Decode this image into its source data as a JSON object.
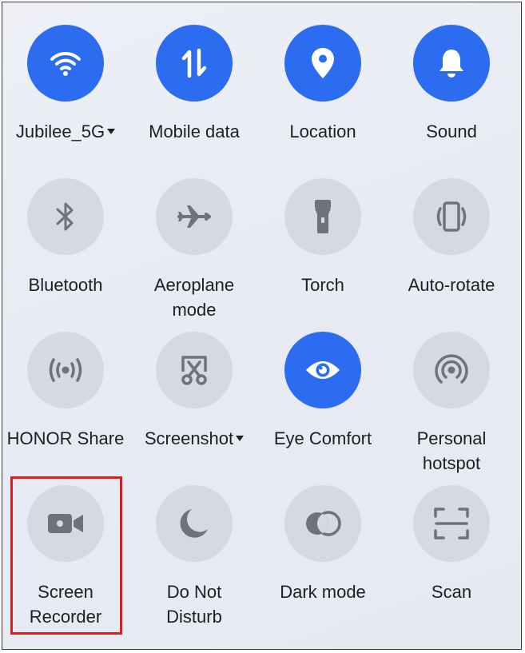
{
  "colors": {
    "active_tile": "#2b6cf0",
    "inactive_tile": "#d6d9e0",
    "active_icon": "#ffffff",
    "inactive_icon": "#6f7379",
    "highlight_border": "#e01b1b"
  },
  "tiles": [
    {
      "label": "Jubilee_5G",
      "icon": "wifi-icon",
      "active": true,
      "dropdown": true
    },
    {
      "label": "Mobile data",
      "icon": "mobile-data-icon",
      "active": true
    },
    {
      "label": "Location",
      "icon": "location-pin-icon",
      "active": true
    },
    {
      "label": "Sound",
      "icon": "bell-icon",
      "active": true
    },
    {
      "label": "Bluetooth",
      "icon": "bluetooth-icon",
      "active": false
    },
    {
      "label_line1": "Aeroplane",
      "label_line2": "mode",
      "icon": "airplane-icon",
      "active": false
    },
    {
      "label": "Torch",
      "icon": "flashlight-icon",
      "active": false
    },
    {
      "label": "Auto-rotate",
      "icon": "auto-rotate-icon",
      "active": false
    },
    {
      "label": "HONOR Share",
      "icon": "share-wave-icon",
      "active": false
    },
    {
      "label": "Screenshot",
      "icon": "screenshot-scissors-icon",
      "active": false,
      "dropdown": true
    },
    {
      "label": "Eye Comfort",
      "icon": "eye-icon",
      "active": true
    },
    {
      "label_line1": "Personal",
      "label_line2": "hotspot",
      "icon": "hotspot-icon",
      "active": false
    },
    {
      "label_line1": "Screen",
      "label_line2": "Recorder",
      "icon": "video-camera-icon",
      "active": false,
      "highlighted": true
    },
    {
      "label_line1": "Do Not",
      "label_line2": "Disturb",
      "icon": "moon-icon",
      "active": false
    },
    {
      "label": "Dark mode",
      "icon": "dark-mode-icon",
      "active": false
    },
    {
      "label": "Scan",
      "icon": "scan-frame-icon",
      "active": false
    }
  ]
}
